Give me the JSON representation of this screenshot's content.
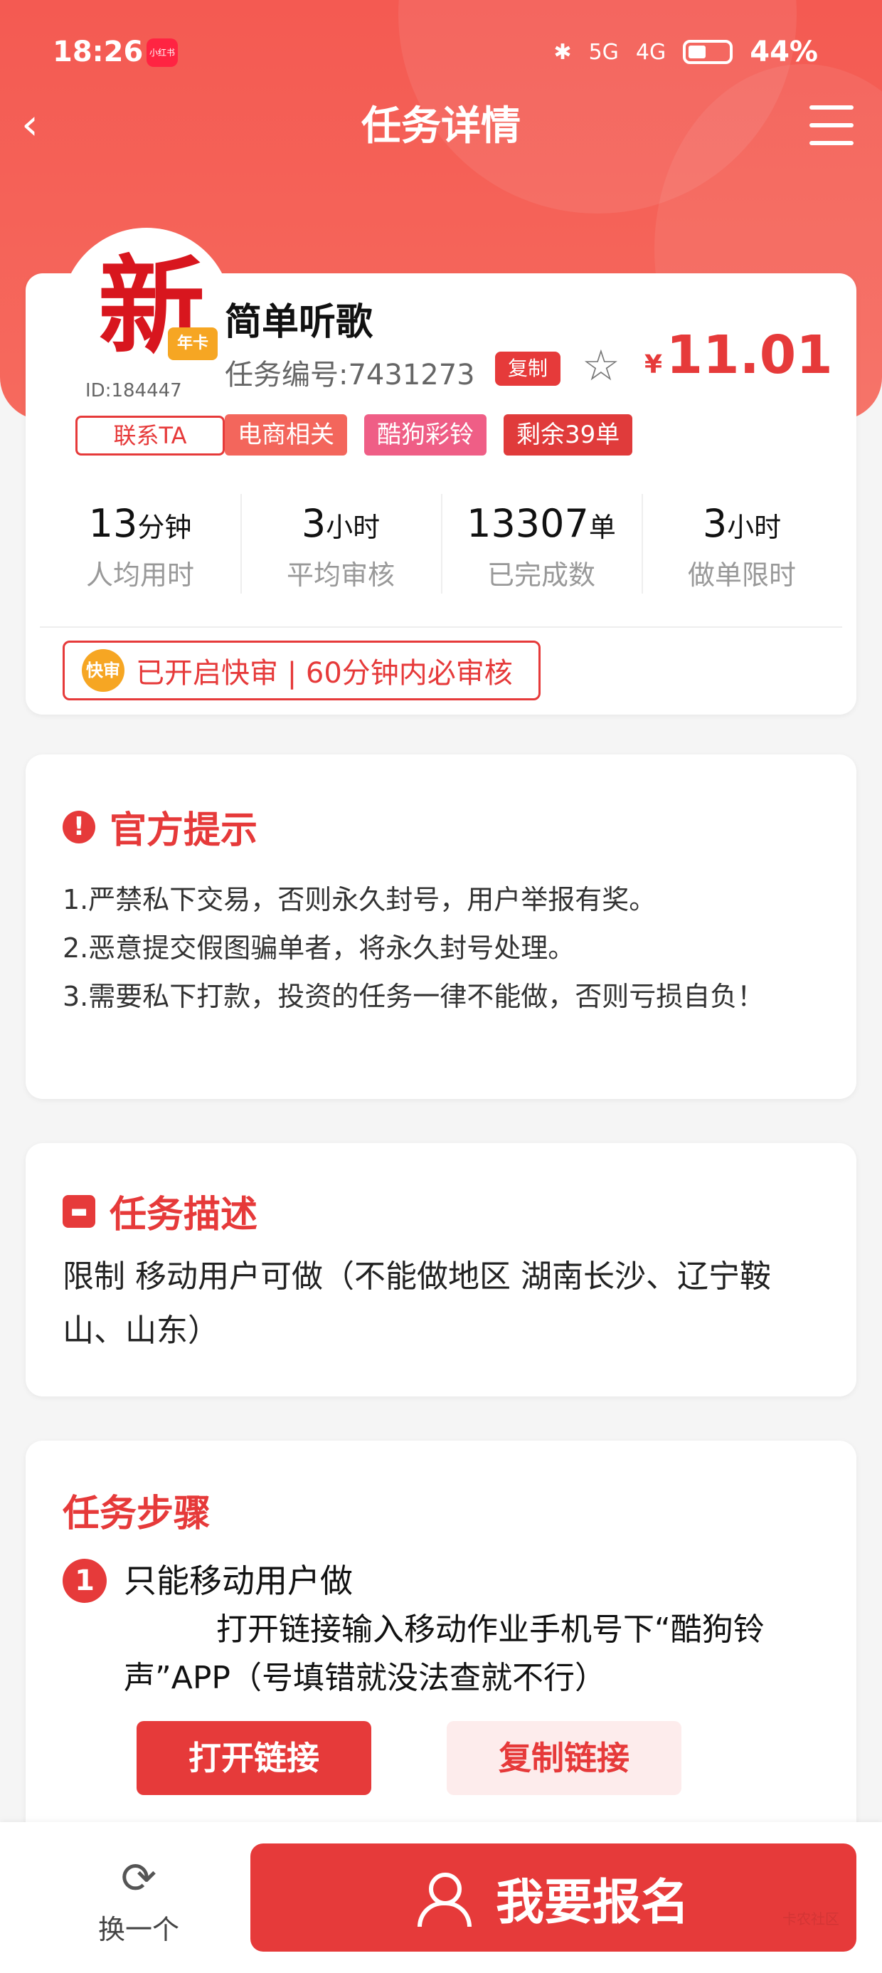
{
  "status": {
    "time": "18:26",
    "app_badge": "小红书",
    "network1": "5G",
    "network2": "4G",
    "battery": "44%"
  },
  "nav": {
    "title": "任务详情"
  },
  "task": {
    "avatar_char": "新",
    "avatar_badge": "年卡",
    "user_id": "ID:184447",
    "contact": "联系TA",
    "title": "简单听歌",
    "task_no": "任务编号:7431273",
    "copy": "复制",
    "price_currency": "¥",
    "price": "11.01",
    "tags": [
      "电商相关",
      "酷狗彩铃",
      "剩余39单"
    ]
  },
  "stats": [
    {
      "value": "13",
      "unit": "分钟",
      "label": "人均用时"
    },
    {
      "value": "3",
      "unit": "小时",
      "label": "平均审核"
    },
    {
      "value": "13307",
      "unit": "单",
      "label": "已完成数"
    },
    {
      "value": "3",
      "unit": "小时",
      "label": "做单限时"
    }
  ],
  "fast_review": {
    "icon": "快审",
    "text": "已开启快审 | 60分钟内必审核"
  },
  "notice": {
    "title": "官方提示",
    "items": [
      "1.严禁私下交易，否则永久封号，用户举报有奖。",
      "2.恶意提交假图骗单者，将永久封号处理。",
      "3.需要私下打款，投资的任务一律不能做，否则亏损自负！"
    ]
  },
  "description": {
    "title": "任务描述",
    "text": "限制 移动用户可做（不能做地区 湖南长沙、辽宁鞍山、山东）"
  },
  "steps": {
    "title": "任务步骤",
    "items": [
      {
        "num": "1",
        "title": "只能移动用户做",
        "desc": "打开链接输入移动作业手机号下“酷狗铃声”APP（号填错就没法查就不行）",
        "open_label": "打开链接",
        "copy_label": "复制链接"
      }
    ]
  },
  "bottom": {
    "switch_label": "换一个",
    "signup_label": "我要报名",
    "watermark": "卡农社区"
  },
  "colors": {
    "accent": "#e63a3a",
    "header": "#f45a52"
  }
}
